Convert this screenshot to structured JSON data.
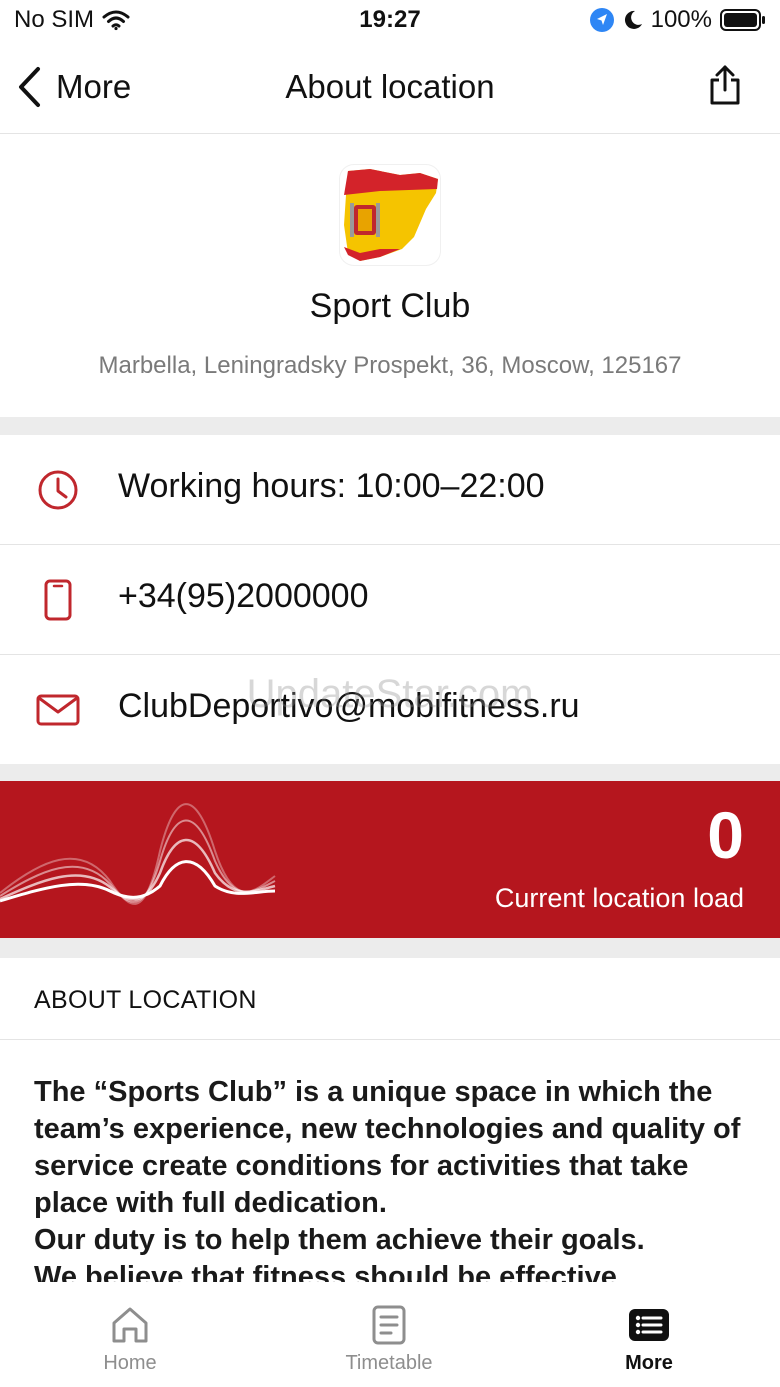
{
  "status_bar": {
    "carrier": "No SIM",
    "time": "19:27",
    "battery": "100%"
  },
  "nav": {
    "back_label": "More",
    "title": "About location"
  },
  "club": {
    "name": "Sport Club",
    "address": "Marbella, Leningradsky Prospekt, 36, Moscow, 125167"
  },
  "info": {
    "hours": "Working hours: 10:00–22:00",
    "phone": "+34(95)2000000",
    "email": "ClubDeportivo@mobifitness.ru"
  },
  "load": {
    "value": "0",
    "label": "Current location load"
  },
  "about": {
    "heading": "ABOUT LOCATION",
    "paragraphs": [
      "The “Sports Club” is a unique space in which the team’s experience, new technologies and quality of service create conditions for activities that take place with full dedication.",
      "Our duty is to help them achieve their goals.",
      "We believe that fitness should be effective"
    ]
  },
  "tabs": [
    {
      "label": "Home",
      "icon": "home-icon"
    },
    {
      "label": "Timetable",
      "icon": "timetable-icon"
    },
    {
      "label": "More",
      "icon": "more-list-icon"
    }
  ],
  "watermark": "UpdateStar.com",
  "colors": {
    "accent": "#b5161e",
    "icon_red": "#c0272d"
  }
}
